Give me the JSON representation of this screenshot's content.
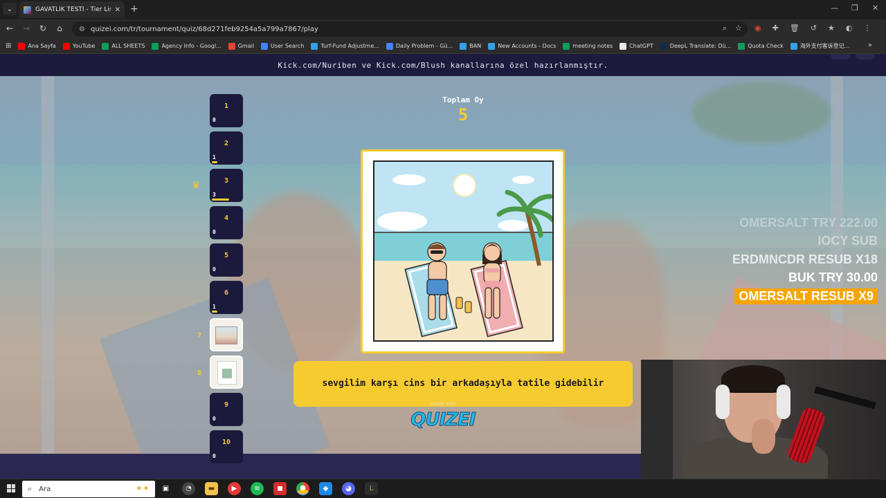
{
  "browser": {
    "tab_title": "GAVATLIK TESTİ - Tier List, Kör",
    "url": "quizei.com/tr/tournament/quiz/68d271feb9254a5a799a7867/play",
    "bookmarks": [
      {
        "label": "Ana Sayfa",
        "color": "#ff0000"
      },
      {
        "label": "YouTube",
        "color": "#ff0000"
      },
      {
        "label": "ALL SHEETS",
        "color": "#0f9d58"
      },
      {
        "label": "Agency Info - Googl...",
        "color": "#0f9d58"
      },
      {
        "label": "Gmail",
        "color": "#ea4335"
      },
      {
        "label": "User Search",
        "color": "#4285f4"
      },
      {
        "label": "Turf-Fund Adjustme...",
        "color": "#34a0e8"
      },
      {
        "label": "Daily Problem - Gü...",
        "color": "#4285f4"
      },
      {
        "label": "BAN",
        "color": "#34a0e8"
      },
      {
        "label": "New Accounts - Docs",
        "color": "#34a0e8"
      },
      {
        "label": "meeting notes",
        "color": "#0f9d58"
      },
      {
        "label": "ChatGPT",
        "color": "#e8e8e8"
      },
      {
        "label": "DeepL Translate: Dü...",
        "color": "#0f2b46"
      },
      {
        "label": "Quota Check",
        "color": "#0f9d58"
      },
      {
        "label": "海外支付客诉登记...",
        "color": "#34a0e8"
      }
    ]
  },
  "page": {
    "banner": "Kick.com/Nuriben ve Kick.com/Blush kanallarına özel hazırlanmıştır.",
    "total_votes_label": "Toplam Oy",
    "total_votes": "5",
    "caption": "sevgilim karşı cins bir arkadaşıyla tatile gidebilir",
    "made_with": "made with",
    "logo": "QUIZEI",
    "slots": [
      {
        "number": "1",
        "votes": "0",
        "fraction": 0
      },
      {
        "number": "2",
        "votes": "1",
        "fraction": 0.2
      },
      {
        "number": "3",
        "votes": "3",
        "fraction": 0.6,
        "leader": true
      },
      {
        "number": "4",
        "votes": "0",
        "fraction": 0
      },
      {
        "number": "5",
        "votes": "0",
        "fraction": 0
      },
      {
        "number": "6",
        "votes": "1",
        "fraction": 0.2
      },
      {
        "number": "7",
        "thumbnail": true
      },
      {
        "number": "8",
        "thumbnail": true
      },
      {
        "number": "9",
        "votes": "0",
        "fraction": 0
      },
      {
        "number": "10",
        "votes": "0",
        "fraction": 0
      }
    ]
  },
  "stream": {
    "alerts": [
      "OMERSALT TRY 222.00",
      "IOCY SUB",
      "ERDMNCDR RESUB X18",
      "BUK TRY 30.00",
      "OMERSALT RESUB X9"
    ]
  },
  "taskbar": {
    "search_placeholder": "Ara"
  },
  "colors": {
    "accent": "#f6cb2f",
    "banner_bg": "#1d1b3d",
    "slot_bg": "#1c1a3c",
    "alert_highlight": "#f6a400"
  }
}
